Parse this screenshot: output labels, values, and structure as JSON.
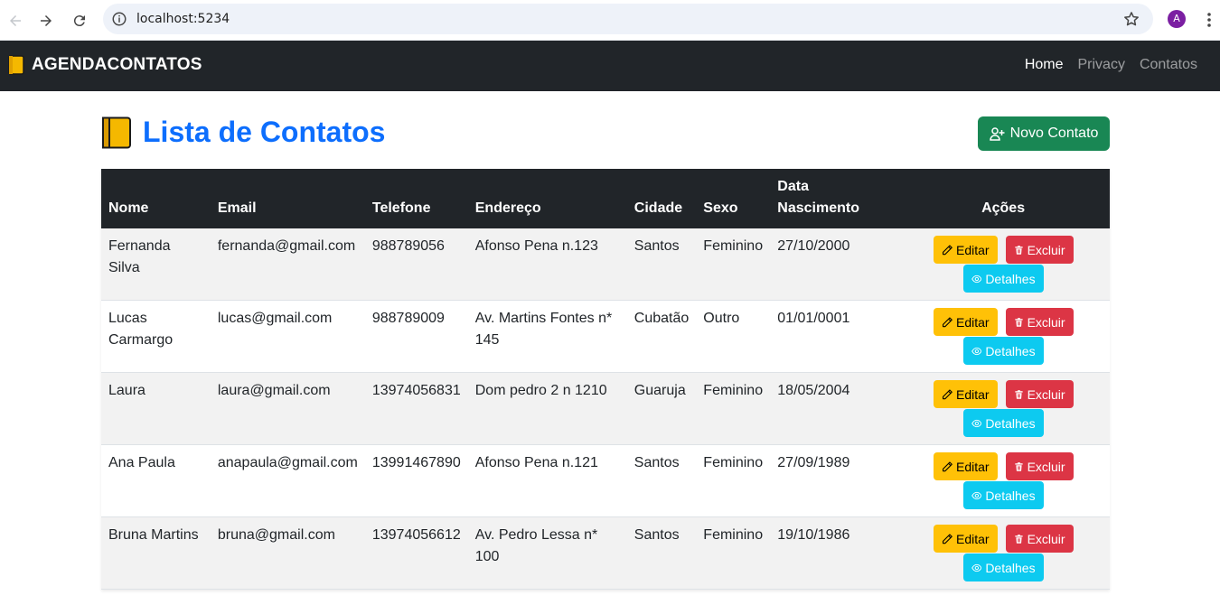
{
  "browser": {
    "url": "localhost:5234",
    "avatar_letter": "A"
  },
  "navbar": {
    "brand": "AGENDACONTATOS",
    "links": [
      "Home",
      "Privacy",
      "Contatos"
    ]
  },
  "page": {
    "title": "Lista de Contatos",
    "new_button": "Novo Contato"
  },
  "table": {
    "headers": {
      "nome": "Nome",
      "email": "Email",
      "telefone": "Telefone",
      "endereco": "Endereço",
      "cidade": "Cidade",
      "sexo": "Sexo",
      "data_nascimento": "Data Nascimento",
      "acoes": "Ações"
    },
    "action_labels": {
      "edit": "Editar",
      "delete": "Excluir",
      "details": "Detalhes"
    },
    "rows": [
      {
        "nome": "Fernanda Silva",
        "email": "fernanda@gmail.com",
        "telefone": "988789056",
        "endereco": "Afonso Pena n.123",
        "cidade": "Santos",
        "sexo": "Feminino",
        "data": "27/10/2000"
      },
      {
        "nome": "Lucas Carmargo",
        "email": "lucas@gmail.com",
        "telefone": "988789009",
        "endereco": "Av. Martins Fontes n* 145",
        "cidade": "Cubatão",
        "sexo": "Outro",
        "data": "01/01/0001"
      },
      {
        "nome": "Laura",
        "email": "laura@gmail.com",
        "telefone": "13974056831",
        "endereco": "Dom pedro 2 n 1210",
        "cidade": "Guaruja",
        "sexo": "Feminino",
        "data": "18/05/2004"
      },
      {
        "nome": "Ana Paula",
        "email": "anapaula@gmail.com",
        "telefone": "13991467890",
        "endereco": "Afonso Pena n.121",
        "cidade": "Santos",
        "sexo": "Feminino",
        "data": "27/09/1989"
      },
      {
        "nome": "Bruna Martins",
        "email": "bruna@gmail.com",
        "telefone": "13974056612",
        "endereco": "Av. Pedro Lessa n* 100",
        "cidade": "Santos",
        "sexo": "Feminino",
        "data": "19/10/1986"
      }
    ]
  },
  "colors": {
    "navbar_bg": "#212529",
    "title": "#0d6efd",
    "new_button": "#198754",
    "edit": "#ffc107",
    "delete": "#dc3545",
    "details": "#0dcaf0"
  },
  "icons": {
    "back": "arrow-left-icon",
    "forward": "arrow-right-icon",
    "reload": "reload-icon",
    "site_info": "info-icon",
    "bookmark": "star-icon",
    "menu": "kebab-menu-icon",
    "brand": "notebook-icon",
    "new_contact": "person-plus-icon",
    "edit": "pencil-icon",
    "delete": "trash-icon",
    "details": "eye-icon"
  }
}
